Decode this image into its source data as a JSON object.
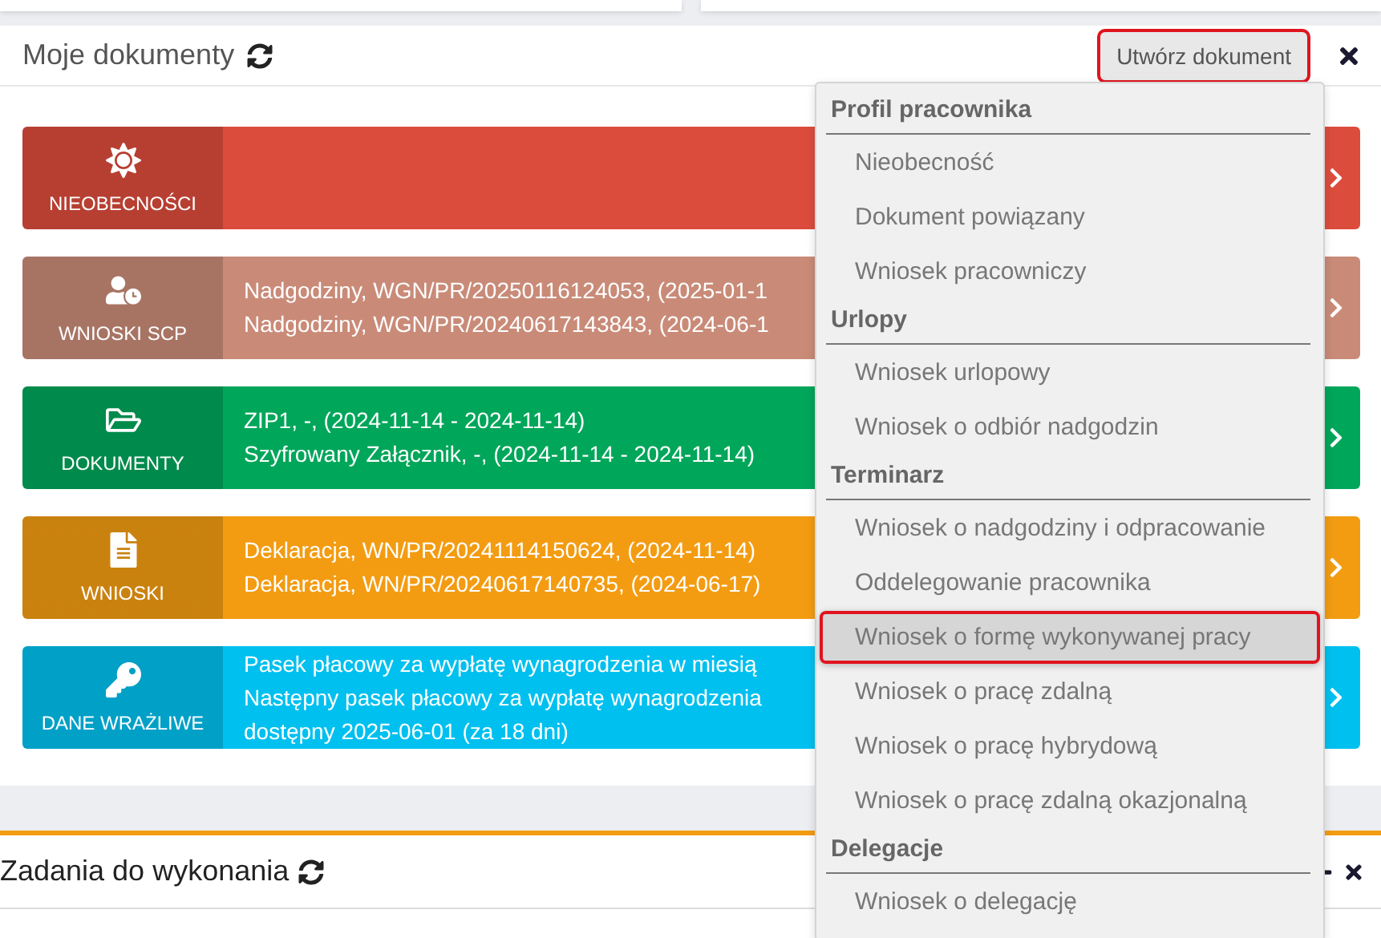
{
  "documents_panel": {
    "title": "Moje dokumenty",
    "create_button": {
      "label": "Utwórz dokument",
      "highlighted": true
    },
    "tiles": [
      {
        "label": "NIEOBECNOŚCI",
        "color": "#dc4c3c"
      },
      {
        "label": "WNIOSKI SCP",
        "color": "#c98b78",
        "lines": [
          "Nadgodziny, WGN/PR/20250116124053, (2025-01-1",
          "Nadgodziny, WGN/PR/20240617143843, (2024-06-1"
        ]
      },
      {
        "label": "DOKUMENTY",
        "color": "#00a65a",
        "lines": [
          "ZIP1, -, (2024-11-14 - 2024-11-14)",
          "Szyfrowany Załącznik, -, (2024-11-14 - 2024-11-14)"
        ]
      },
      {
        "label": "WNIOSKI",
        "color": "#f39c12",
        "lines": [
          "Deklaracja, WN/PR/20241114150624, (2024-11-14)",
          "Deklaracja, WN/PR/20240617140735, (2024-06-17)"
        ]
      },
      {
        "label": "DANE WRAŻLIWE",
        "color": "#00c0ef",
        "lines": [
          "Pasek płacowy za wypłatę wynagrodzenia w miesią",
          "Następny pasek płacowy za wypłatę wynagrodzenia",
          "dostępny 2025-06-01 (za 18 dni)"
        ]
      }
    ]
  },
  "create_menu": [
    {
      "heading": "Profil pracownika",
      "items": [
        {
          "label": "Nieobecność",
          "highlighted": false
        },
        {
          "label": "Dokument powiązany",
          "highlighted": false
        },
        {
          "label": "Wniosek pracowniczy",
          "highlighted": false
        }
      ]
    },
    {
      "heading": "Urlopy",
      "items": [
        {
          "label": "Wniosek urlopowy",
          "highlighted": false
        },
        {
          "label": "Wniosek o odbiór nadgodzin",
          "highlighted": false
        }
      ]
    },
    {
      "heading": "Terminarz",
      "items": [
        {
          "label": "Wniosek o nadgodziny i odpracowanie",
          "highlighted": false
        },
        {
          "label": "Oddelegowanie pracownika",
          "highlighted": false
        },
        {
          "label": "Wniosek o formę wykonywanej pracy",
          "highlighted": true
        },
        {
          "label": "Wniosek o pracę zdalną",
          "highlighted": false
        },
        {
          "label": "Wniosek o pracę hybrydową",
          "highlighted": false
        },
        {
          "label": "Wniosek o pracę zdalną okazjonalną",
          "highlighted": false
        }
      ]
    },
    {
      "heading": "Delegacje",
      "items": [
        {
          "label": "Wniosek o delegację",
          "highlighted": false
        }
      ]
    }
  ],
  "tasks_panel": {
    "title": "Zadania do wykonania"
  }
}
